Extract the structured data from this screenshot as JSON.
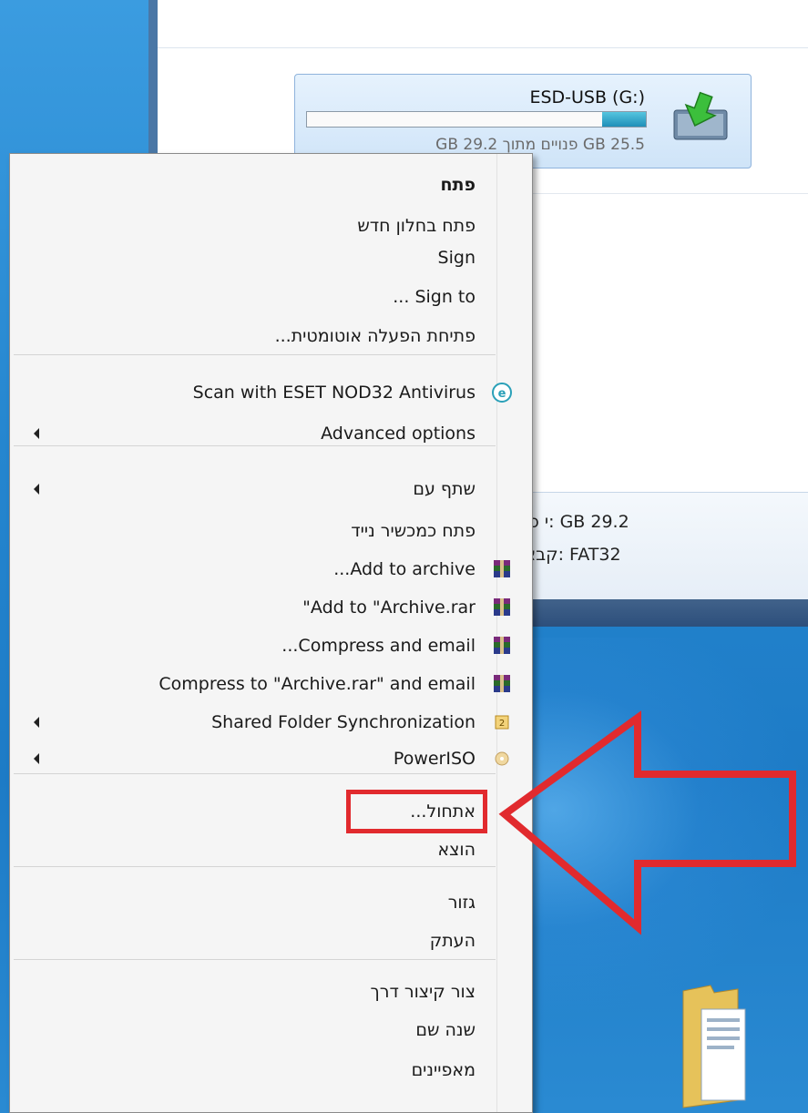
{
  "drive": {
    "name": "ESD-USB (G:)",
    "free_text": "25.5 GB פנויים מתוך 29.2 GB",
    "used_fraction": 0.13
  },
  "details": {
    "total_line": "29.2 GB :י כולל",
    "fs_line": "FAT32 :קבצים"
  },
  "menu": {
    "items": [
      {
        "label": "פתח",
        "bold": true
      },
      {
        "label": "פתח בחלון חדש"
      },
      {
        "label": "Sign"
      },
      {
        "label": "Sign to ..."
      },
      {
        "label": "פתיחת הפעלה אוטומטית..."
      },
      {
        "label": "Scan with ESET NOD32 Antivirus",
        "icon": "eset-icon"
      },
      {
        "label": "Advanced options",
        "submenu": true
      },
      {
        "label": "שתף עם",
        "submenu": true
      },
      {
        "label": "פתח כמכשיר נייד"
      },
      {
        "label": "Add to archive...",
        "icon": "winrar-icon"
      },
      {
        "label": "Add to \"Archive.rar\"",
        "icon": "winrar-icon"
      },
      {
        "label": "Compress and email...",
        "icon": "winrar-icon"
      },
      {
        "label": "Compress to \"Archive.rar\" and email",
        "icon": "winrar-icon"
      },
      {
        "label": "Shared Folder Synchronization",
        "icon": "sync-icon",
        "submenu": true
      },
      {
        "label": "PowerISO",
        "icon": "poweriso-icon",
        "submenu": true
      },
      {
        "label": "אתחול..."
      },
      {
        "label": "הוצא"
      },
      {
        "label": "גזור"
      },
      {
        "label": "העתק"
      },
      {
        "label": "צור קיצור דרך"
      },
      {
        "label": "שנה שם"
      },
      {
        "label": "מאפיינים"
      }
    ]
  },
  "colors": {
    "highlight": "#e12a2e",
    "desktop": "#2586cf",
    "window_border": "#4a77a6"
  }
}
